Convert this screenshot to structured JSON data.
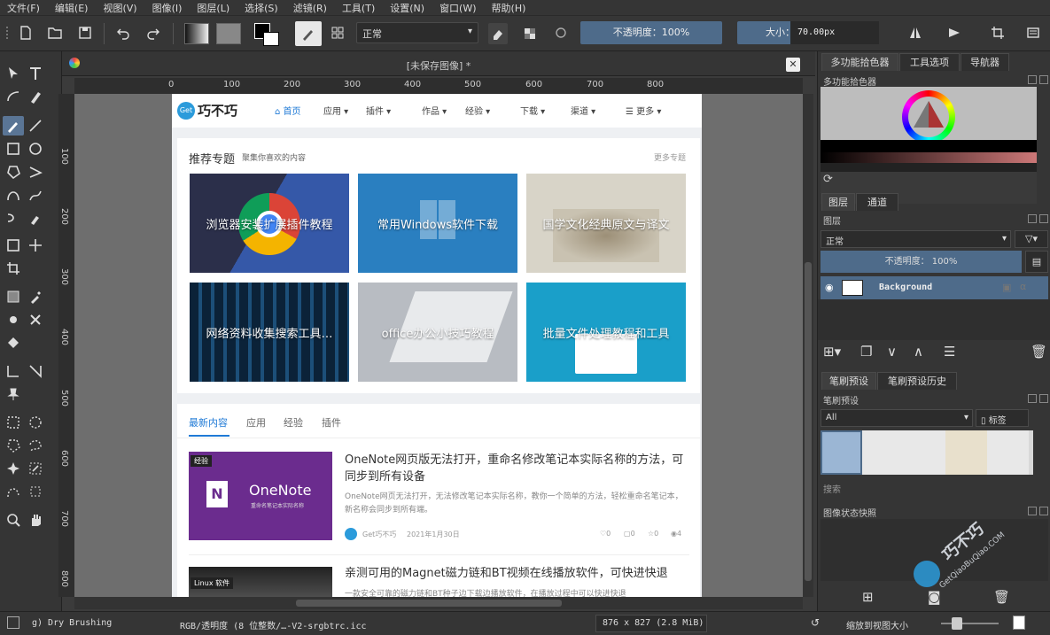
{
  "menu": [
    "文件(F)",
    "编辑(E)",
    "视图(V)",
    "图像(I)",
    "图层(L)",
    "选择(S)",
    "滤镜(R)",
    "工具(T)",
    "设置(N)",
    "窗口(W)",
    "帮助(H)"
  ],
  "toolbar": {
    "blend_mode": "正常",
    "opacity_label": "不透明度：100%",
    "size_label": "大小：",
    "size_value": "70.00px"
  },
  "document": {
    "title": "[未保存图像] *"
  },
  "ruler": {
    "h_ticks": [
      "0",
      "100",
      "200",
      "300",
      "400",
      "500",
      "600",
      "700",
      "800"
    ],
    "v_ticks": [
      "100",
      "200",
      "300",
      "400",
      "500",
      "600",
      "700",
      "800"
    ]
  },
  "website": {
    "logo_text": "巧不巧",
    "logo_badge": "Get",
    "nav": [
      "首页",
      "应用",
      "插件",
      "作品",
      "经验",
      "下载",
      "渠道",
      "更多"
    ],
    "topics_title": "推荐专题",
    "topics_sub": "聚集你喜欢的内容",
    "topics_more": "更多专题",
    "topic_cards": [
      {
        "label": "浏览器安装扩展插件教程",
        "color": "#2c3a64"
      },
      {
        "label": "常用Windows软件下载",
        "color": "#2a7fc0"
      },
      {
        "label": "国学文化经典原文与译文",
        "color": "#d8d4c8"
      },
      {
        "label": "网络资料收集搜索工具…",
        "color": "#0f2a44"
      },
      {
        "label": "office办公小技巧教程",
        "color": "#b8bcc2"
      },
      {
        "label": "批量文件处理教程和工具",
        "color": "#1a9fc9"
      }
    ],
    "news_tabs": [
      "最新内容",
      "应用",
      "经验",
      "插件"
    ],
    "articles": [
      {
        "badge": "经验",
        "thumb_text": "OneNote",
        "thumb_sub": "重命名笔记本实际名称",
        "title": "OneNote网页版无法打开，重命名修改笔记本实际名称的方法，可同步到所有设备",
        "desc": "OneNote网页无法打开，无法修改笔记本实际名称，教你一个简单的方法，轻松重命名笔记本，新名称会同步到所有端。",
        "author": "Get巧不巧",
        "date": "2021年1月30日",
        "likes": "0",
        "comments": "0",
        "stars": "0",
        "views": "4"
      },
      {
        "badge": "Linux 软件",
        "title": "亲测可用的Magnet磁力链和BT视频在线播放软件，可快进快退",
        "desc": "一款安全可靠的磁力链和BT种子边下载边播放软件，在播放过程中可以快进快退"
      }
    ]
  },
  "panels": {
    "top_tabs": [
      "多功能拾色器",
      "工具选项",
      "导航器"
    ],
    "color_picker_title": "多功能拾色器",
    "layer_tabs": [
      "图层",
      "通道"
    ],
    "layers_title": "图层",
    "layer_blend": "正常",
    "layer_opacity": "不透明度：  100%",
    "layer_name": "Background",
    "brush_tabs": [
      "笔刷预设",
      "笔刷预设历史"
    ],
    "brush_title": "笔刷预设",
    "brush_filter": "All",
    "brush_tag": "标签",
    "brush_search": "搜索",
    "snapshot_title": "图像状态快照"
  },
  "status": {
    "brush": "g) Dry Brushing",
    "color_space": "RGB/透明度 (8 位整数/…-V2-srgbtrc.icc",
    "dimensions": "876 x 827 (2.8 MiB)",
    "zoom_label": "缩放到视图大小"
  },
  "watermark": {
    "text": "巧不巧",
    "url": "GetQiaoBuQiao.COM"
  }
}
